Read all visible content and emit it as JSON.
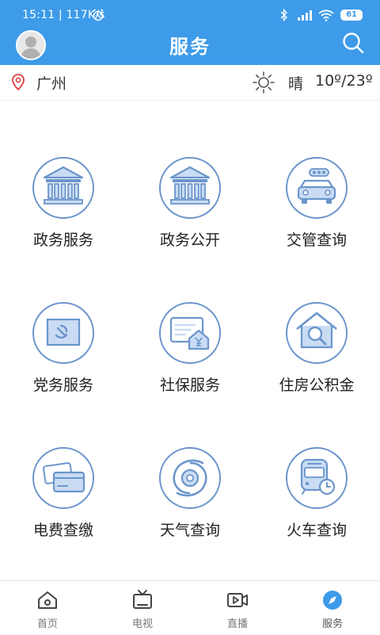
{
  "status_bar": {
    "time_speed": "15:11 | 117K/s",
    "battery": "61",
    "alarm_icon": "alarm-icon",
    "bluetooth_icon": "bluetooth-icon",
    "signal_icon": "signal-icon",
    "wifi_icon": "wifi-icon"
  },
  "header": {
    "title": "服务",
    "avatar_icon": "avatar-icon",
    "search_icon": "search-icon"
  },
  "location_bar": {
    "city": "广州",
    "weather": "晴",
    "temperature": "10º/23º",
    "location_icon": "location-pin-icon",
    "weather_icon": "sun-icon"
  },
  "services": [
    {
      "label": "政务服务",
      "icon": "government-building-icon"
    },
    {
      "label": "政务公开",
      "icon": "government-building-icon"
    },
    {
      "label": "交管查询",
      "icon": "car-icon"
    },
    {
      "label": "党务服务",
      "icon": "party-flag-icon"
    },
    {
      "label": "社保服务",
      "icon": "social-security-icon"
    },
    {
      "label": "住房公积金",
      "icon": "house-search-icon"
    },
    {
      "label": "电费查缴",
      "icon": "bank-card-icon"
    },
    {
      "label": "天气查询",
      "icon": "typhoon-icon"
    },
    {
      "label": "火车查询",
      "icon": "train-clock-icon"
    }
  ],
  "tabs": [
    {
      "label": "首页",
      "icon": "home-icon"
    },
    {
      "label": "电视",
      "icon": "tv-icon"
    },
    {
      "label": "直播",
      "icon": "video-live-icon"
    },
    {
      "label": "服务",
      "icon": "compass-icon"
    }
  ],
  "colors": {
    "primary": "#3d9be9",
    "icon_blue": "#6b95cc",
    "icon_fill": "#c9dcf3"
  }
}
